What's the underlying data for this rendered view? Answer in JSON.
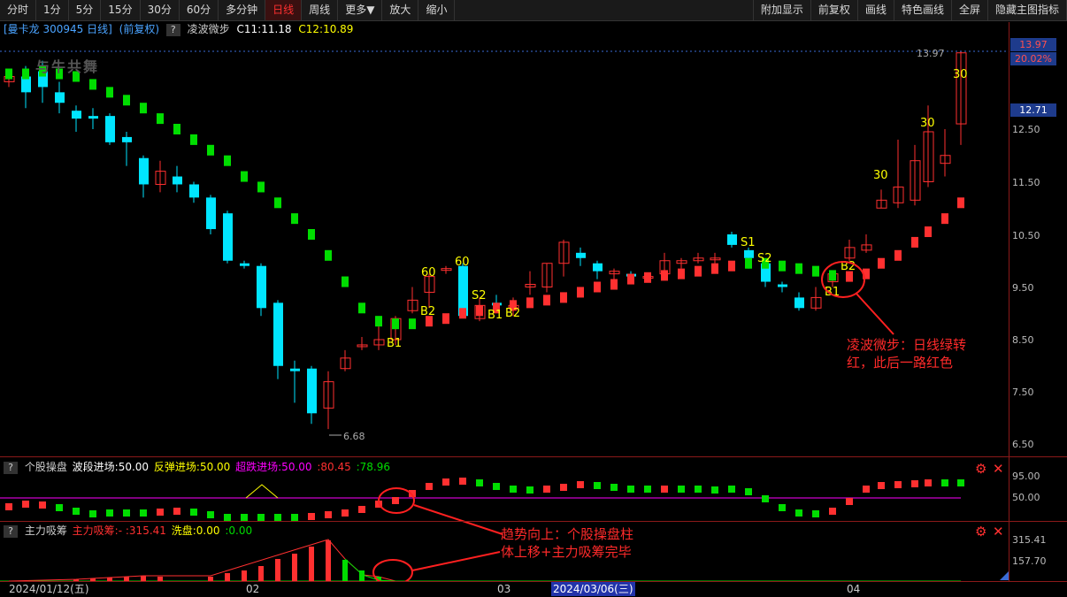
{
  "toolbar": {
    "left": [
      "分时",
      "1分",
      "5分",
      "15分",
      "30分",
      "60分",
      "多分钟",
      "日线",
      "周线",
      "更多▼",
      "放大",
      "缩小"
    ],
    "right": [
      "附加显示",
      "前复权",
      "画线",
      "特色画线",
      "全屏",
      "隐藏主图指标"
    ],
    "active": "日线"
  },
  "header": {
    "stock": "[曼卡龙 300945 日线]",
    "adjust": "(前复权)",
    "help": "?",
    "indicator": "凌波微步",
    "c1": "C11:11.18",
    "c2": "C12:10.89"
  },
  "main_axis": {
    "labels": [
      "12.50",
      "11.50",
      "10.50",
      "9.50",
      "8.50",
      "7.50",
      "6.50"
    ],
    "tag_high": "13.97",
    "tag_pct": "20.02%",
    "tag_last": "12.71",
    "high_mark": "13.97",
    "low_mark": "6.68"
  },
  "signals": {
    "b1": "B1",
    "b2": "B2",
    "s1": "S1",
    "s2": "S2",
    "n30": "30",
    "n60": "60"
  },
  "panel2": {
    "help": "?",
    "name": "个股操盘",
    "a": "波段进场:50.00",
    "b": "反弹进场:50.00",
    "c": "超跌进场:50.00",
    "d": ":80.45",
    "e": ":78.96",
    "axis": [
      "95.00",
      "50.00"
    ]
  },
  "panel3": {
    "help": "?",
    "name": "主力吸筹",
    "a": "主力吸筹:-",
    "b": ":315.41",
    "c": "洗盘:0.00",
    "d": ":0.00",
    "axis": [
      "315.41",
      "157.70"
    ]
  },
  "dates": {
    "start": "2024/01/12(五)",
    "m2": "02",
    "m3": "03",
    "cursor": "2024/03/06(三)",
    "m4": "04"
  },
  "annotations": {
    "note1_line1": "凌波微步：日线绿转",
    "note1_line2": "红，此后一路红色",
    "note2_line1": "趋势向上：个股操盘柱",
    "note2_line2": "体上移+主力吸筹完毕"
  },
  "watermark": "与牛共舞",
  "colors": {
    "up": "#ff3030",
    "down": "#00e5ff",
    "green": "#00dd00",
    "yellow": "#ffff00",
    "magenta": "#ff00ff",
    "axis": "#8b1a1a"
  }
}
